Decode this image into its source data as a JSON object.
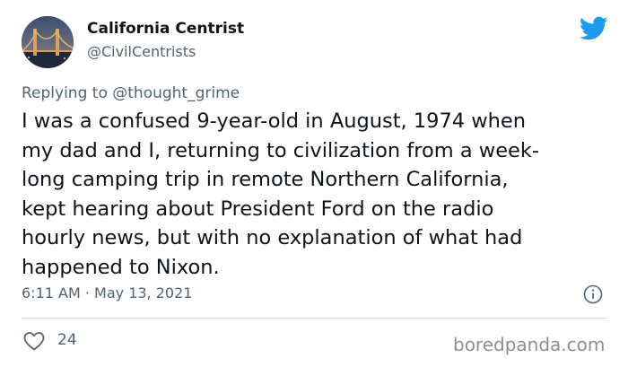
{
  "author": {
    "display_name": "California Centrist",
    "handle": "@CivilCentrists",
    "avatar_icon": "golden-gate-bridge-avatar"
  },
  "brand": {
    "icon": "twitter-bird-icon",
    "color": "#1d9bf0"
  },
  "reply": {
    "prefix": "Replying to ",
    "mention": "@thought_grime"
  },
  "tweet": {
    "text": "I was a confused 9-year-old in August, 1974 when\nmy dad and I, returning to civilization from a week-\nlong camping trip in remote Northern California,\nkept hearing about President Ford on the radio\nhourly news, but with no explanation of what had\nhappened to Nixon.",
    "timestamp": "6:11 AM · May 13, 2021"
  },
  "actions": {
    "like_icon": "heart-icon",
    "like_count": "24",
    "info_icon": "info-icon"
  },
  "watermark": {
    "text": "boredpanda.com"
  }
}
